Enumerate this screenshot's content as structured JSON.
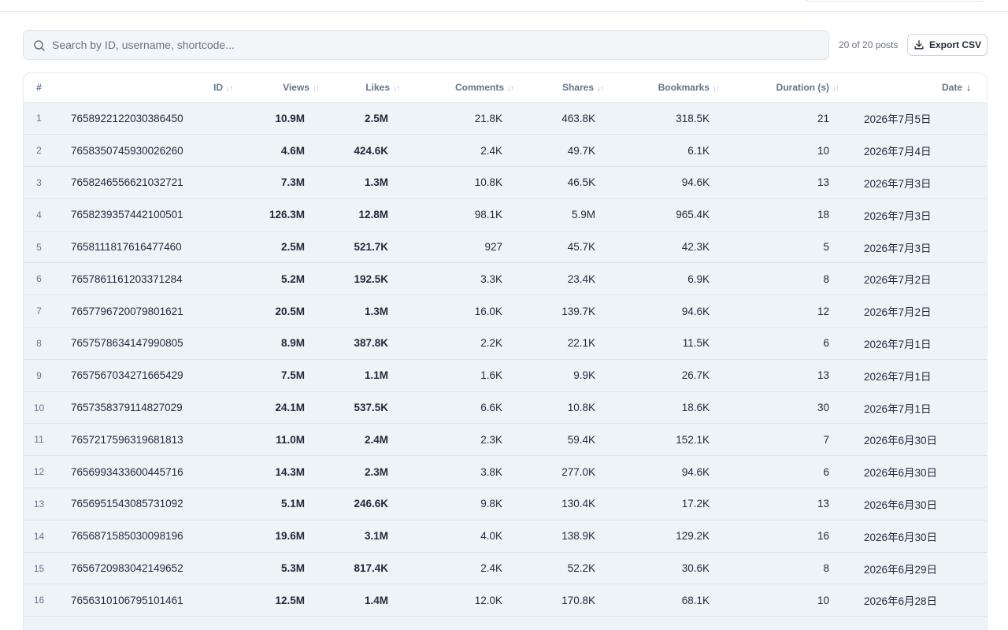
{
  "search": {
    "placeholder": "Search by ID, username, shortcode..."
  },
  "count_label": "20 of 20 posts",
  "export_label": "Export CSV",
  "columns": {
    "num": "#",
    "id": "ID",
    "views": "Views",
    "likes": "Likes",
    "comments": "Comments",
    "shares": "Shares",
    "bookmarks": "Bookmarks",
    "duration": "Duration (s)",
    "date": "Date"
  },
  "sort": {
    "inactive_glyph": "↓↑",
    "active_glyph": "↓"
  },
  "rows": [
    {
      "num": "1",
      "id": "7658922122030386450",
      "views": "10.9M",
      "likes": "2.5M",
      "comments": "21.8K",
      "shares": "463.8K",
      "bookmarks": "318.5K",
      "duration": "21",
      "date": "2026年7月5日"
    },
    {
      "num": "2",
      "id": "7658350745930026260",
      "views": "4.6M",
      "likes": "424.6K",
      "comments": "2.4K",
      "shares": "49.7K",
      "bookmarks": "6.1K",
      "duration": "10",
      "date": "2026年7月4日"
    },
    {
      "num": "3",
      "id": "7658246556621032721",
      "views": "7.3M",
      "likes": "1.3M",
      "comments": "10.8K",
      "shares": "46.5K",
      "bookmarks": "94.6K",
      "duration": "13",
      "date": "2026年7月3日"
    },
    {
      "num": "4",
      "id": "7658239357442100501",
      "views": "126.3M",
      "likes": "12.8M",
      "comments": "98.1K",
      "shares": "5.9M",
      "bookmarks": "965.4K",
      "duration": "18",
      "date": "2026年7月3日"
    },
    {
      "num": "5",
      "id": "7658111817616477460",
      "views": "2.5M",
      "likes": "521.7K",
      "comments": "927",
      "shares": "45.7K",
      "bookmarks": "42.3K",
      "duration": "5",
      "date": "2026年7月3日"
    },
    {
      "num": "6",
      "id": "7657861161203371284",
      "views": "5.2M",
      "likes": "192.5K",
      "comments": "3.3K",
      "shares": "23.4K",
      "bookmarks": "6.9K",
      "duration": "8",
      "date": "2026年7月2日"
    },
    {
      "num": "7",
      "id": "7657796720079801621",
      "views": "20.5M",
      "likes": "1.3M",
      "comments": "16.0K",
      "shares": "139.7K",
      "bookmarks": "94.6K",
      "duration": "12",
      "date": "2026年7月2日"
    },
    {
      "num": "8",
      "id": "7657578634147990805",
      "views": "8.9M",
      "likes": "387.8K",
      "comments": "2.2K",
      "shares": "22.1K",
      "bookmarks": "11.5K",
      "duration": "6",
      "date": "2026年7月1日"
    },
    {
      "num": "9",
      "id": "7657567034271665429",
      "views": "7.5M",
      "likes": "1.1M",
      "comments": "1.6K",
      "shares": "9.9K",
      "bookmarks": "26.7K",
      "duration": "13",
      "date": "2026年7月1日"
    },
    {
      "num": "10",
      "id": "7657358379114827029",
      "views": "24.1M",
      "likes": "537.5K",
      "comments": "6.6K",
      "shares": "10.8K",
      "bookmarks": "18.6K",
      "duration": "30",
      "date": "2026年7月1日"
    },
    {
      "num": "11",
      "id": "7657217596319681813",
      "views": "11.0M",
      "likes": "2.4M",
      "comments": "2.3K",
      "shares": "59.4K",
      "bookmarks": "152.1K",
      "duration": "7",
      "date": "2026年6月30日"
    },
    {
      "num": "12",
      "id": "7656993433600445716",
      "views": "14.3M",
      "likes": "2.3M",
      "comments": "3.8K",
      "shares": "277.0K",
      "bookmarks": "94.6K",
      "duration": "6",
      "date": "2026年6月30日"
    },
    {
      "num": "13",
      "id": "7656951543085731092",
      "views": "5.1M",
      "likes": "246.6K",
      "comments": "9.8K",
      "shares": "130.4K",
      "bookmarks": "17.2K",
      "duration": "13",
      "date": "2026年6月30日"
    },
    {
      "num": "14",
      "id": "7656871585030098196",
      "views": "19.6M",
      "likes": "3.1M",
      "comments": "4.0K",
      "shares": "138.9K",
      "bookmarks": "129.2K",
      "duration": "16",
      "date": "2026年6月30日"
    },
    {
      "num": "15",
      "id": "7656720983042149652",
      "views": "5.3M",
      "likes": "817.4K",
      "comments": "2.4K",
      "shares": "52.2K",
      "bookmarks": "30.6K",
      "duration": "8",
      "date": "2026年6月29日"
    },
    {
      "num": "16",
      "id": "7656310106795101461",
      "views": "12.5M",
      "likes": "1.4M",
      "comments": "12.0K",
      "shares": "170.8K",
      "bookmarks": "68.1K",
      "duration": "10",
      "date": "2026年6月28日"
    }
  ]
}
